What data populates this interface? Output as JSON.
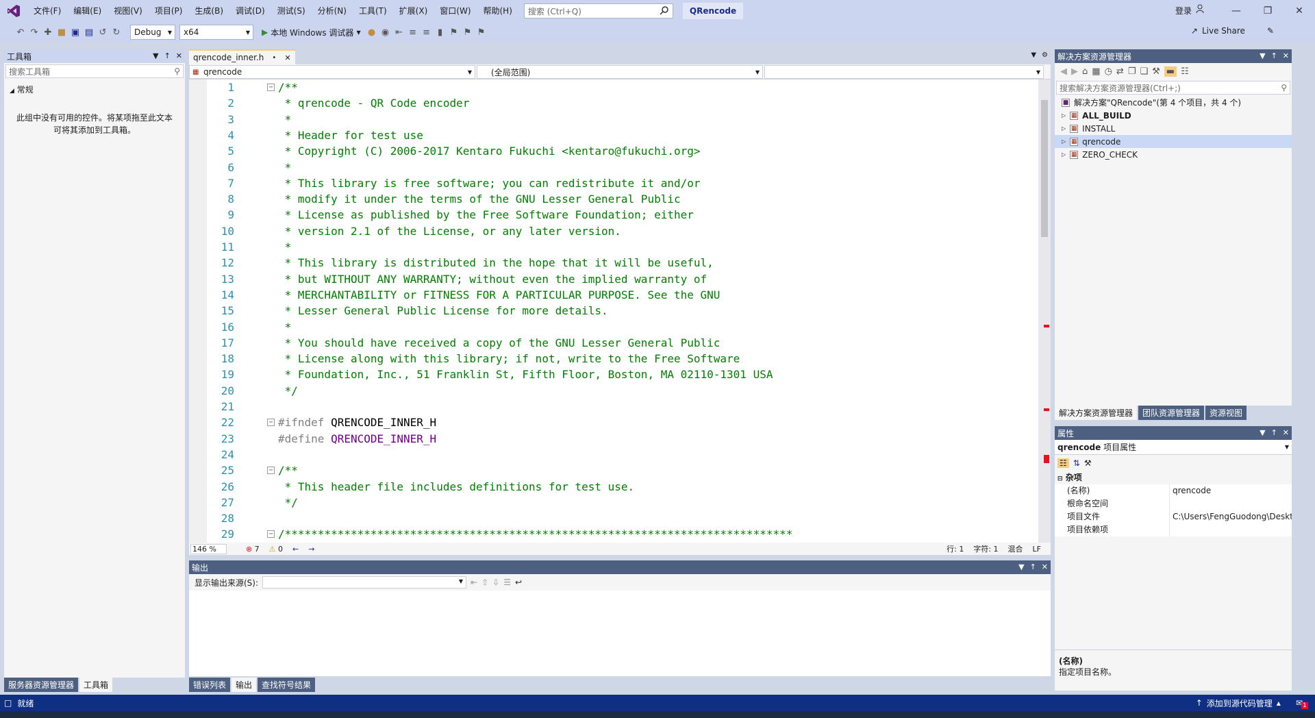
{
  "menubar": {
    "items": [
      "文件(F)",
      "编辑(E)",
      "视图(V)",
      "项目(P)",
      "生成(B)",
      "调试(D)",
      "测试(S)",
      "分析(N)",
      "工具(T)",
      "扩展(X)",
      "窗口(W)",
      "帮助(H)"
    ],
    "search_placeholder": "搜索 (Ctrl+Q)",
    "solution_name": "QRencode",
    "login": "登录"
  },
  "toolbar": {
    "config": "Debug",
    "platform": "x64",
    "run_label": "本地 Windows 调试器",
    "live_share": "Live Share"
  },
  "toolbox": {
    "title": "工具箱",
    "search_placeholder": "搜索工具箱",
    "group": "常规",
    "empty_line1": "此组中没有可用的控件。将某项拖至此文本",
    "empty_line2": "可将其添加到工具箱。",
    "bottom_tabs": [
      "服务器资源管理器",
      "工具箱"
    ]
  },
  "editor": {
    "tab_name": "qrencode_inner.h",
    "nav_project": "qrencode",
    "nav_scope": "(全局范围)",
    "zoom": "146 %",
    "errors": "7",
    "warnings": "0",
    "line": "行: 1",
    "col": "字符: 1",
    "mixed": "混合",
    "eol": "LF",
    "lines": [
      {
        "n": "1",
        "text": "/**",
        "fold": true,
        "kind": "comment"
      },
      {
        "n": "2",
        "text": " * qrencode - QR Code encoder",
        "kind": "comment"
      },
      {
        "n": "3",
        "text": " *",
        "kind": "comment"
      },
      {
        "n": "4",
        "text": " * Header for test use",
        "kind": "comment"
      },
      {
        "n": "5",
        "text": " * Copyright (C) 2006-2017 Kentaro Fukuchi <kentaro@fukuchi.org>",
        "kind": "comment"
      },
      {
        "n": "6",
        "text": " *",
        "kind": "comment"
      },
      {
        "n": "7",
        "text": " * This library is free software; you can redistribute it and/or",
        "kind": "comment"
      },
      {
        "n": "8",
        "text": " * modify it under the terms of the GNU Lesser General Public",
        "kind": "comment"
      },
      {
        "n": "9",
        "text": " * License as published by the Free Software Foundation; either",
        "kind": "comment"
      },
      {
        "n": "10",
        "text": " * version 2.1 of the License, or any later version.",
        "kind": "comment"
      },
      {
        "n": "11",
        "text": " *",
        "kind": "comment"
      },
      {
        "n": "12",
        "text": " * This library is distributed in the hope that it will be useful,",
        "kind": "comment"
      },
      {
        "n": "13",
        "text": " * but WITHOUT ANY WARRANTY; without even the implied warranty of",
        "kind": "comment"
      },
      {
        "n": "14",
        "text": " * MERCHANTABILITY or FITNESS FOR A PARTICULAR PURPOSE. See the GNU",
        "kind": "comment"
      },
      {
        "n": "15",
        "text": " * Lesser General Public License for more details.",
        "kind": "comment"
      },
      {
        "n": "16",
        "text": " *",
        "kind": "comment"
      },
      {
        "n": "17",
        "text": " * You should have received a copy of the GNU Lesser General Public",
        "kind": "comment"
      },
      {
        "n": "18",
        "text": " * License along with this library; if not, write to the Free Software",
        "kind": "comment"
      },
      {
        "n": "19",
        "text": " * Foundation, Inc., 51 Franklin St, Fifth Floor, Boston, MA 02110-1301 USA",
        "kind": "comment"
      },
      {
        "n": "20",
        "text": " */",
        "kind": "comment"
      },
      {
        "n": "21",
        "text": "",
        "kind": "blank"
      },
      {
        "n": "22",
        "text": "#ifndef ",
        "ident": "QRENCODE_INNER_H",
        "fold": true,
        "kind": "pp-id"
      },
      {
        "n": "23",
        "text": "#define ",
        "ident": "QRENCODE_INNER_H",
        "kind": "pp-macro"
      },
      {
        "n": "24",
        "text": "",
        "kind": "blank"
      },
      {
        "n": "25",
        "text": "/**",
        "fold": true,
        "kind": "comment"
      },
      {
        "n": "26",
        "text": " * This header file includes definitions for test use.",
        "kind": "comment"
      },
      {
        "n": "27",
        "text": " */",
        "kind": "comment"
      },
      {
        "n": "28",
        "text": "",
        "kind": "blank"
      },
      {
        "n": "29",
        "text": "/*****************************************************************************",
        "fold": true,
        "kind": "comment"
      }
    ]
  },
  "output": {
    "title": "输出",
    "source_label": "显示输出来源(S):",
    "bottom_tabs": [
      "错误列表",
      "输出",
      "查找符号结果"
    ]
  },
  "solution_explorer": {
    "title": "解决方案资源管理器",
    "search_placeholder": "搜索解决方案资源管理器(Ctrl+;)",
    "solution_line": "解决方案\"QRencode\"(第 4 个项目，共 4 个)",
    "projects": [
      "ALL_BUILD",
      "INSTALL",
      "qrencode",
      "ZERO_CHECK"
    ],
    "selected": "qrencode",
    "bottom_tabs": [
      "解决方案资源管理器",
      "团队资源管理器",
      "资源视图"
    ]
  },
  "properties": {
    "title": "属性",
    "object_name": "qrencode",
    "object_type": "项目属性",
    "category": "杂项",
    "rows": [
      {
        "k": "(名称)",
        "v": "qrencode"
      },
      {
        "k": "根命名空间",
        "v": ""
      },
      {
        "k": "项目文件",
        "v": "C:\\Users\\FengGuodong\\Deskt"
      },
      {
        "k": "项目依赖项",
        "v": ""
      }
    ],
    "desc_title": "(名称)",
    "desc_text": "指定项目名称。"
  },
  "statusbar": {
    "ready": "就绪",
    "source_control": "添加到源代码管理",
    "notif_count": "1"
  },
  "colors": {
    "accent": "#0f2f84",
    "panel_title": "#4d6082",
    "comment": "#008000",
    "macro": "#6f008a",
    "line_number": "#2b91af"
  }
}
